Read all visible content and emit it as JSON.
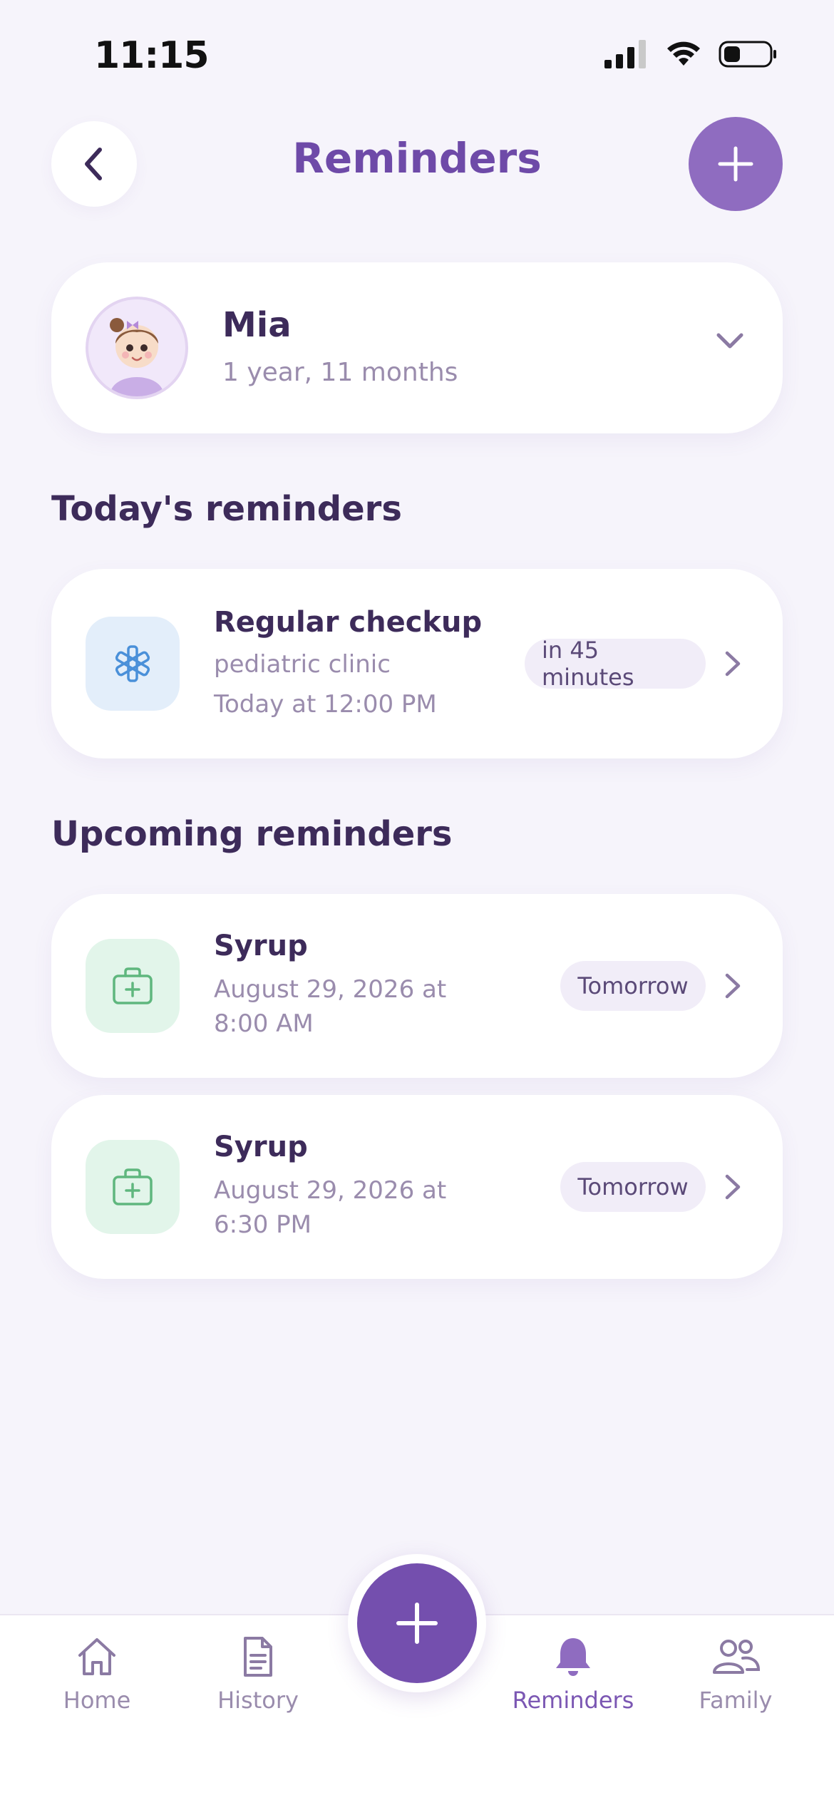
{
  "status_bar": {
    "time": "11:15"
  },
  "header": {
    "title": "Reminders"
  },
  "profile": {
    "name": "Mia",
    "age": "1 year, 11 months"
  },
  "today": {
    "section_title": "Today's reminders",
    "items": [
      {
        "title": "Regular checkup",
        "line1": "pediatric clinic",
        "line2": "Today at 12:00 PM",
        "badge": "in 45 minutes",
        "icon": "medical-asterisk-icon",
        "icon_color": "#4a90d9"
      }
    ]
  },
  "upcoming": {
    "section_title": "Upcoming reminders",
    "items": [
      {
        "title": "Syrup",
        "line1": "August 29, 2026 at",
        "line2": "8:00 AM",
        "badge": "Tomorrow",
        "icon": "medicine-kit-icon",
        "icon_color": "#5fb77e"
      },
      {
        "title": "Syrup",
        "line1": "August 29, 2026 at",
        "line2": "6:30 PM",
        "badge": "Tomorrow",
        "icon": "medicine-kit-icon",
        "icon_color": "#5fb77e"
      }
    ]
  },
  "nav": {
    "items": [
      {
        "label": "Home",
        "icon": "home-icon"
      },
      {
        "label": "History",
        "icon": "document-icon"
      },
      {
        "label": "Reminders",
        "icon": "bell-icon",
        "active": true
      },
      {
        "label": "Family",
        "icon": "family-icon"
      }
    ]
  },
  "colors": {
    "accent": "#7b57b3",
    "title": "#6e4aa8",
    "background": "#f6f4fb"
  }
}
